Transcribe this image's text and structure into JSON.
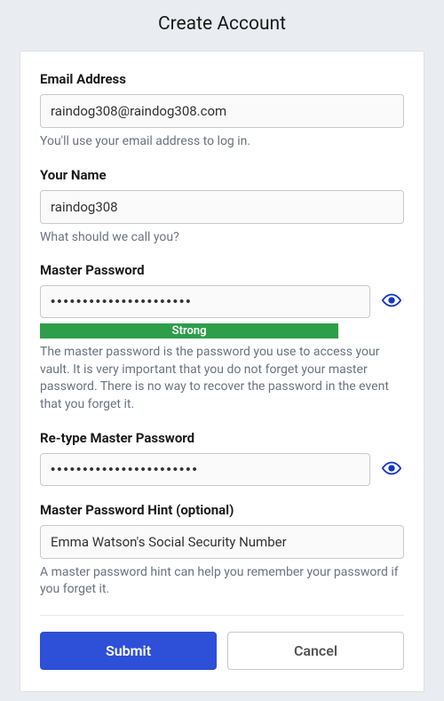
{
  "title": "Create Account",
  "email": {
    "label": "Email Address",
    "value": "raindog308@raindog308.com",
    "helper": "You'll use your email address to log in."
  },
  "name": {
    "label": "Your Name",
    "value": "raindog308",
    "helper": "What should we call you?"
  },
  "password": {
    "label": "Master Password",
    "value": "••••••••••••••••••••••",
    "strength_label": "Strong",
    "helper": "The master password is the password you use to access your vault. It is very important that you do not forget your master password. There is no way to recover the password in the event that you forget it."
  },
  "password_confirm": {
    "label": "Re-type Master Password",
    "value": "•••••••••••••••••••••••"
  },
  "hint": {
    "label": "Master Password Hint (optional)",
    "value": "Emma Watson's Social Security Number",
    "helper": "A master password hint can help you remember your password if you forget it."
  },
  "buttons": {
    "submit": "Submit",
    "cancel": "Cancel"
  },
  "colors": {
    "primary": "#2e4fd7",
    "strength_ok": "#2e9e4a",
    "eye_icon": "#1736c9"
  }
}
